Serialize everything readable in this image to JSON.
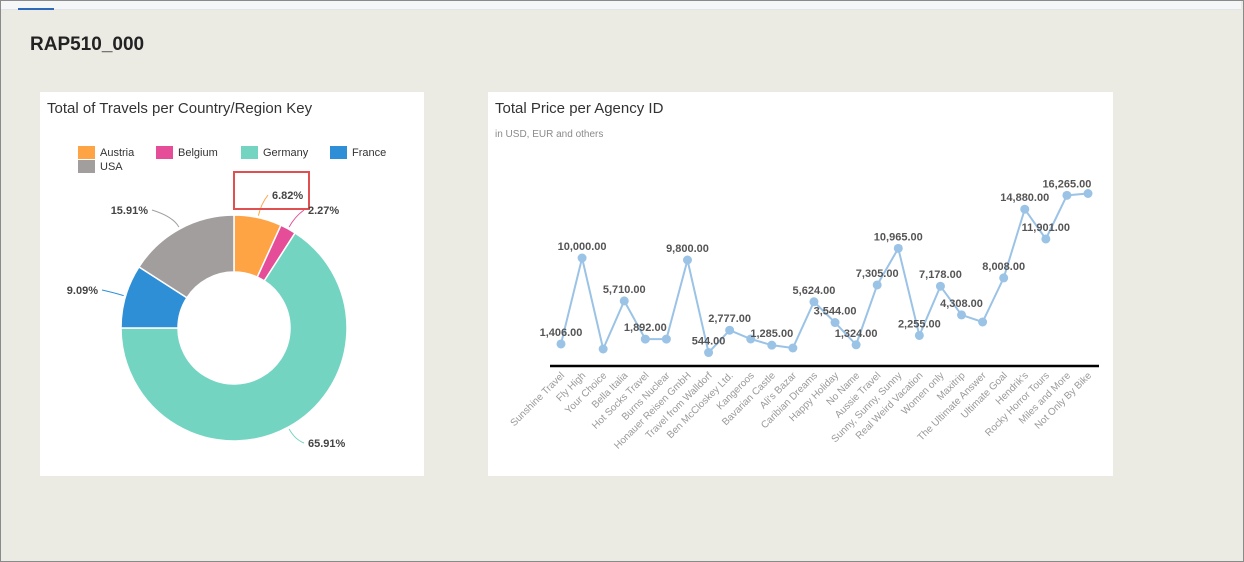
{
  "page": {
    "title": "RAP510_000"
  },
  "chart_data": [
    {
      "type": "pie",
      "variant": "donut",
      "title": "Total of Travels per Country/Region Key",
      "legend_position": "top",
      "categories": [
        "Austria",
        "Belgium",
        "Germany",
        "France",
        "USA"
      ],
      "slice_order": [
        "Austria",
        "Belgium",
        "Germany",
        "France",
        "USA"
      ],
      "values": [
        6.82,
        2.27,
        65.91,
        9.09,
        15.91
      ],
      "value_labels": [
        "6.82%",
        "2.27%",
        "65.91%",
        "9.09%",
        "15.91%"
      ],
      "colors": [
        "#ffa445",
        "#e54d99",
        "#73d4c2",
        "#2f8fd6",
        "#a39e9e"
      ],
      "highlight_color": "#e05050",
      "highlighted_category": "Austria"
    },
    {
      "type": "line",
      "title": "Total Price per Agency ID",
      "subtitle": "in USD, EUR and others",
      "line_color": "#9bc3e6",
      "categories": [
        "Sunshine Travel",
        "Fly High",
        "Your Choice",
        "Bella Italia",
        "Hot Socks Travel",
        "Burns Nuclear",
        "Honauer Reisen GmbH",
        "Travel from Walldorf",
        "Ben McCloskey Ltd.",
        "Kangeroos",
        "Bavarian Castle",
        "Ali's Bazar",
        "Caribian Dreams",
        "Happy Holiday",
        "No Name",
        "Aussie Travel",
        "Sunny, Sunny, Sunny",
        "Real Weird Vacation",
        "Women only",
        "Maxitrip",
        "The Ultimate Answer",
        "Ultimate Goal",
        "Hendrik's",
        "Rocky Horror Tours",
        "Miles and More",
        "Not Only By Bike"
      ],
      "values": [
        1406,
        10000,
        900,
        5710,
        1892,
        1892,
        9800,
        544,
        2777,
        1900,
        1285,
        1000,
        5624,
        3544,
        1324,
        7305,
        10965,
        2255,
        7178,
        4308,
        3600,
        8008,
        14880,
        11901,
        16265,
        16450
      ],
      "data_labels": [
        "1,406.00",
        "10,000.00",
        "",
        "5,710.00",
        "1,892.00",
        "",
        "9,800.00",
        "544.00",
        "2,777.00",
        "",
        "1,285.00",
        "",
        "5,624.00",
        "3,544.00",
        "1,324.00",
        "7,305.00",
        "10,965.00",
        "2,255.00",
        "7,178.00",
        "4,308.00",
        "",
        "8,008.00",
        "14,880.00",
        "11,901.00",
        "16,265.00",
        ""
      ]
    }
  ]
}
